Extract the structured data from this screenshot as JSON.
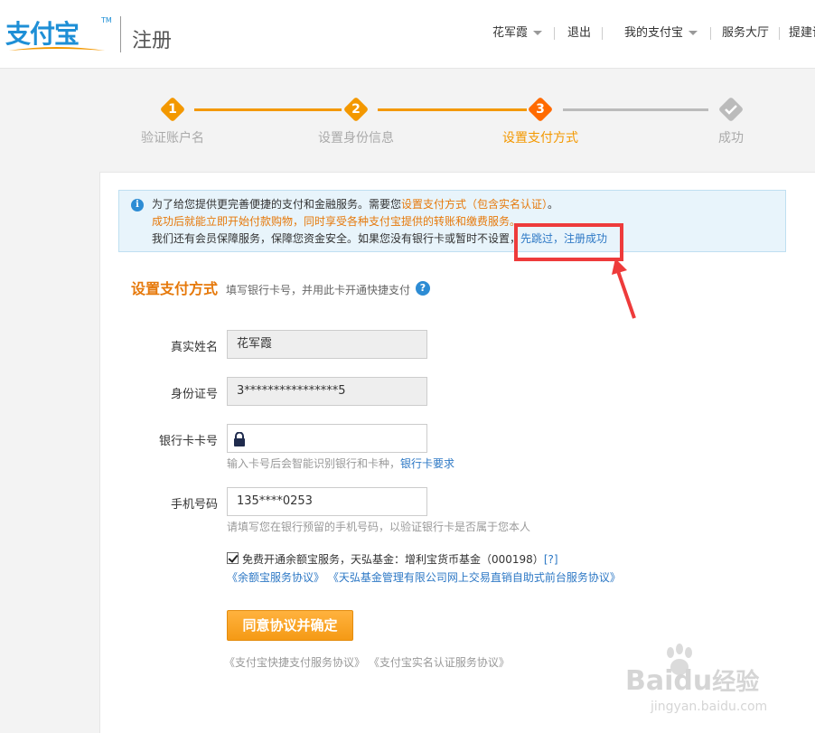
{
  "header": {
    "logo_text": "支付宝",
    "logo_tm": "TM",
    "title": "注册",
    "nav": [
      "花军霞",
      "退出",
      "我的支付宝",
      "服务大厅",
      "提建议"
    ]
  },
  "steps": [
    {
      "num": "1",
      "label": "验证账户名",
      "state": "done"
    },
    {
      "num": "2",
      "label": "设置身份信息",
      "state": "done"
    },
    {
      "num": "3",
      "label": "设置支付方式",
      "state": "current"
    },
    {
      "num": "",
      "label": "成功",
      "state": "pending"
    }
  ],
  "notice": {
    "line1_a": "为了给您提供更完善便捷的支付和金融服务。需要您",
    "line1_b": "设置支付方式（包含实名认证）",
    "line1_c": "。",
    "line2": "成功后就能立即开始付款购物，同时享受各种支付宝提供的转账和缴费服务。",
    "line3_a": "我们还有会员保障服务，保障您资金安全。如果您没有银行卡或暂时不设置，",
    "line3_b": "先跳过，注册成功"
  },
  "section": {
    "title": "设置支付方式",
    "hint": "填写银行卡号，并用此卡开通快捷支付"
  },
  "form": {
    "name_label": "真实姓名",
    "name_value": "花军霞",
    "id_label": "身份证号",
    "id_value": "3****************5",
    "card_label": "银行卡卡号",
    "card_hint_a": "输入卡号后会智能识别银行和卡种，",
    "card_hint_b": "银行卡要求",
    "phone_label": "手机号码",
    "phone_value": "135****0253",
    "phone_hint": "请填写您在银行预留的手机号码，以验证银行卡是否属于您本人"
  },
  "agree": {
    "text": "免费开通余额宝服务，天弘基金：增利宝货币基金（000198）",
    "help": "[?]",
    "link1": "《余额宝服务协议》",
    "link2": "《天弘基金管理有限公司网上交易直销自助式前台服务协议》"
  },
  "submit_label": "同意协议并确定",
  "footer": {
    "link1": "《支付宝快捷支付服务协议》",
    "link2": "《支付宝实名认证服务协议》"
  },
  "watermark": {
    "brand": "Bai",
    "brand_tail": "du",
    "cn": "经验",
    "url": "jingyan.baidu.com"
  },
  "colors": {
    "accent": "#e6790b",
    "step_active": "#f39800",
    "step_current": "#ff6a00",
    "step_pending": "#bbbbbb",
    "link": "#2d78c5",
    "highlight": "#ee3b3b"
  }
}
